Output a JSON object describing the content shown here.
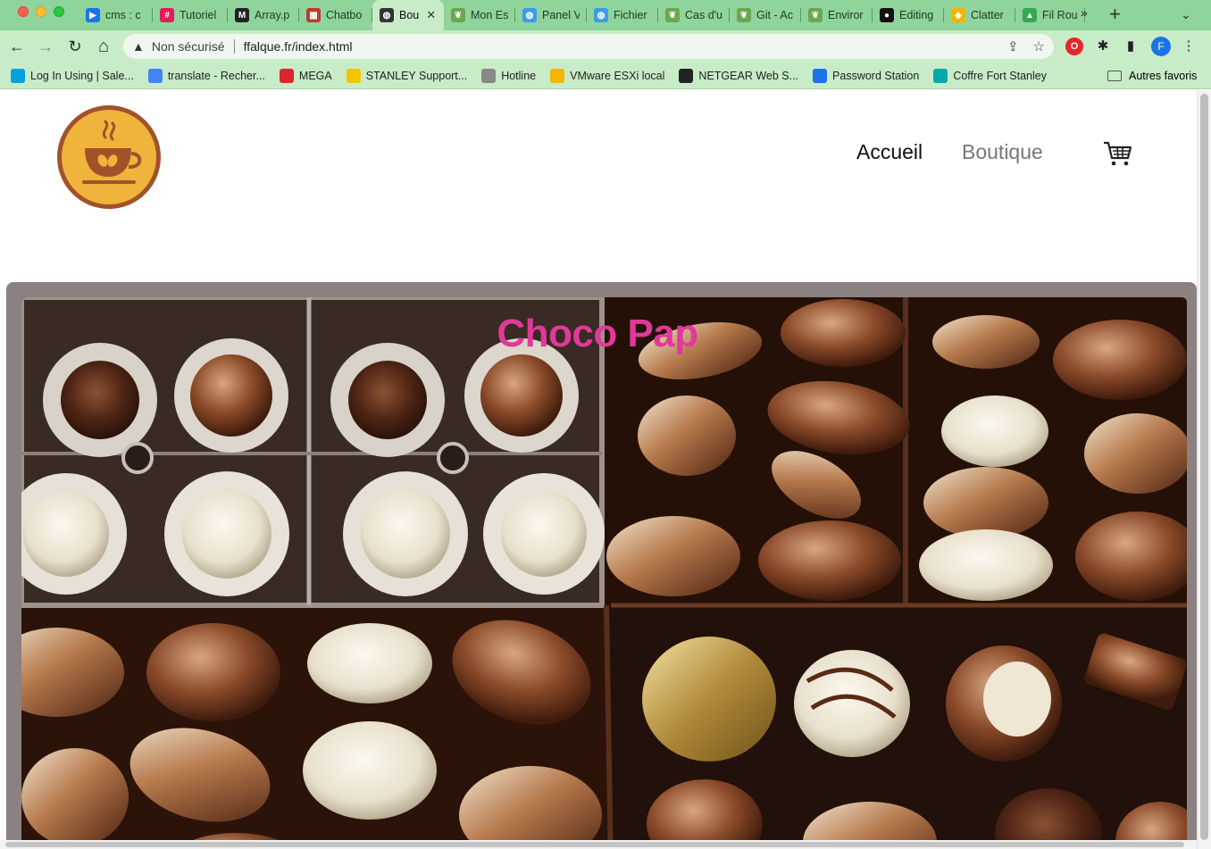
{
  "browser": {
    "tabs": [
      {
        "label": "cms : c",
        "favicon_color": "#1a73e8",
        "icon": "video-icon"
      },
      {
        "label": "Tutoriel",
        "favicon_color": "#e01e5a",
        "icon": "slack-icon"
      },
      {
        "label": "Array.p",
        "favicon_color": "#222222",
        "icon": "m-icon"
      },
      {
        "label": "Chatbo",
        "favicon_color": "#c0392b",
        "icon": "grid-icon"
      },
      {
        "label": "Bou",
        "favicon_color": "#333333",
        "icon": "globe-icon",
        "active": true
      },
      {
        "label": "Mon Es",
        "favicon_color": "#6aa84f",
        "icon": "leaf-icon"
      },
      {
        "label": "Panel V",
        "favicon_color": "#3d9be9",
        "icon": "globe-icon"
      },
      {
        "label": "Fichier",
        "favicon_color": "#3d9be9",
        "icon": "globe-icon"
      },
      {
        "label": "Cas d'u",
        "favicon_color": "#6aa84f",
        "icon": "leaf-icon"
      },
      {
        "label": "Git - Ac",
        "favicon_color": "#6aa84f",
        "icon": "leaf-icon"
      },
      {
        "label": "Enviror",
        "favicon_color": "#6aa84f",
        "icon": "leaf-icon"
      },
      {
        "label": "Editing",
        "favicon_color": "#111111",
        "icon": "github-icon"
      },
      {
        "label": "Clatter",
        "favicon_color": "#f4b400",
        "icon": "pin-icon"
      },
      {
        "label": "Fil Rou",
        "favicon_color": "#34a853",
        "icon": "drive-icon"
      }
    ],
    "active_tab_close": "✕",
    "new_tab": "+",
    "tab_search": "⌄",
    "nav": {
      "back": "←",
      "forward": "→",
      "reload": "↻",
      "home": "⌂"
    },
    "address": {
      "security_label": "Non sécurisé",
      "url": "ffalque.fr/index.html"
    },
    "profile_initial": "F",
    "bookmarks": [
      {
        "label": "Log In Using | Sale...",
        "color": "#00a1e0"
      },
      {
        "label": "translate - Recher...",
        "color": "#4285f4"
      },
      {
        "label": "MEGA",
        "color": "#d9272e"
      },
      {
        "label": "STANLEY Support...",
        "color": "#f2c500"
      },
      {
        "label": "Hotline",
        "color": "#888888"
      },
      {
        "label": "VMware ESXi local",
        "color": "#f4b400"
      },
      {
        "label": "NETGEAR Web S...",
        "color": "#222222"
      },
      {
        "label": "Password Station",
        "color": "#1a73e8"
      },
      {
        "label": "Coffre Fort Stanley",
        "color": "#0aa"
      }
    ],
    "bookmarks_more": "»",
    "other_bookmarks": "Autres favoris"
  },
  "site": {
    "nav": {
      "home": "Accueil",
      "shop": "Boutique"
    },
    "hero_title": "Choco Pap",
    "colors": {
      "title": "#e0399a",
      "logo_fill": "#f0b43c",
      "logo_ring": "#a2522a",
      "frame": "#8c8181"
    }
  }
}
